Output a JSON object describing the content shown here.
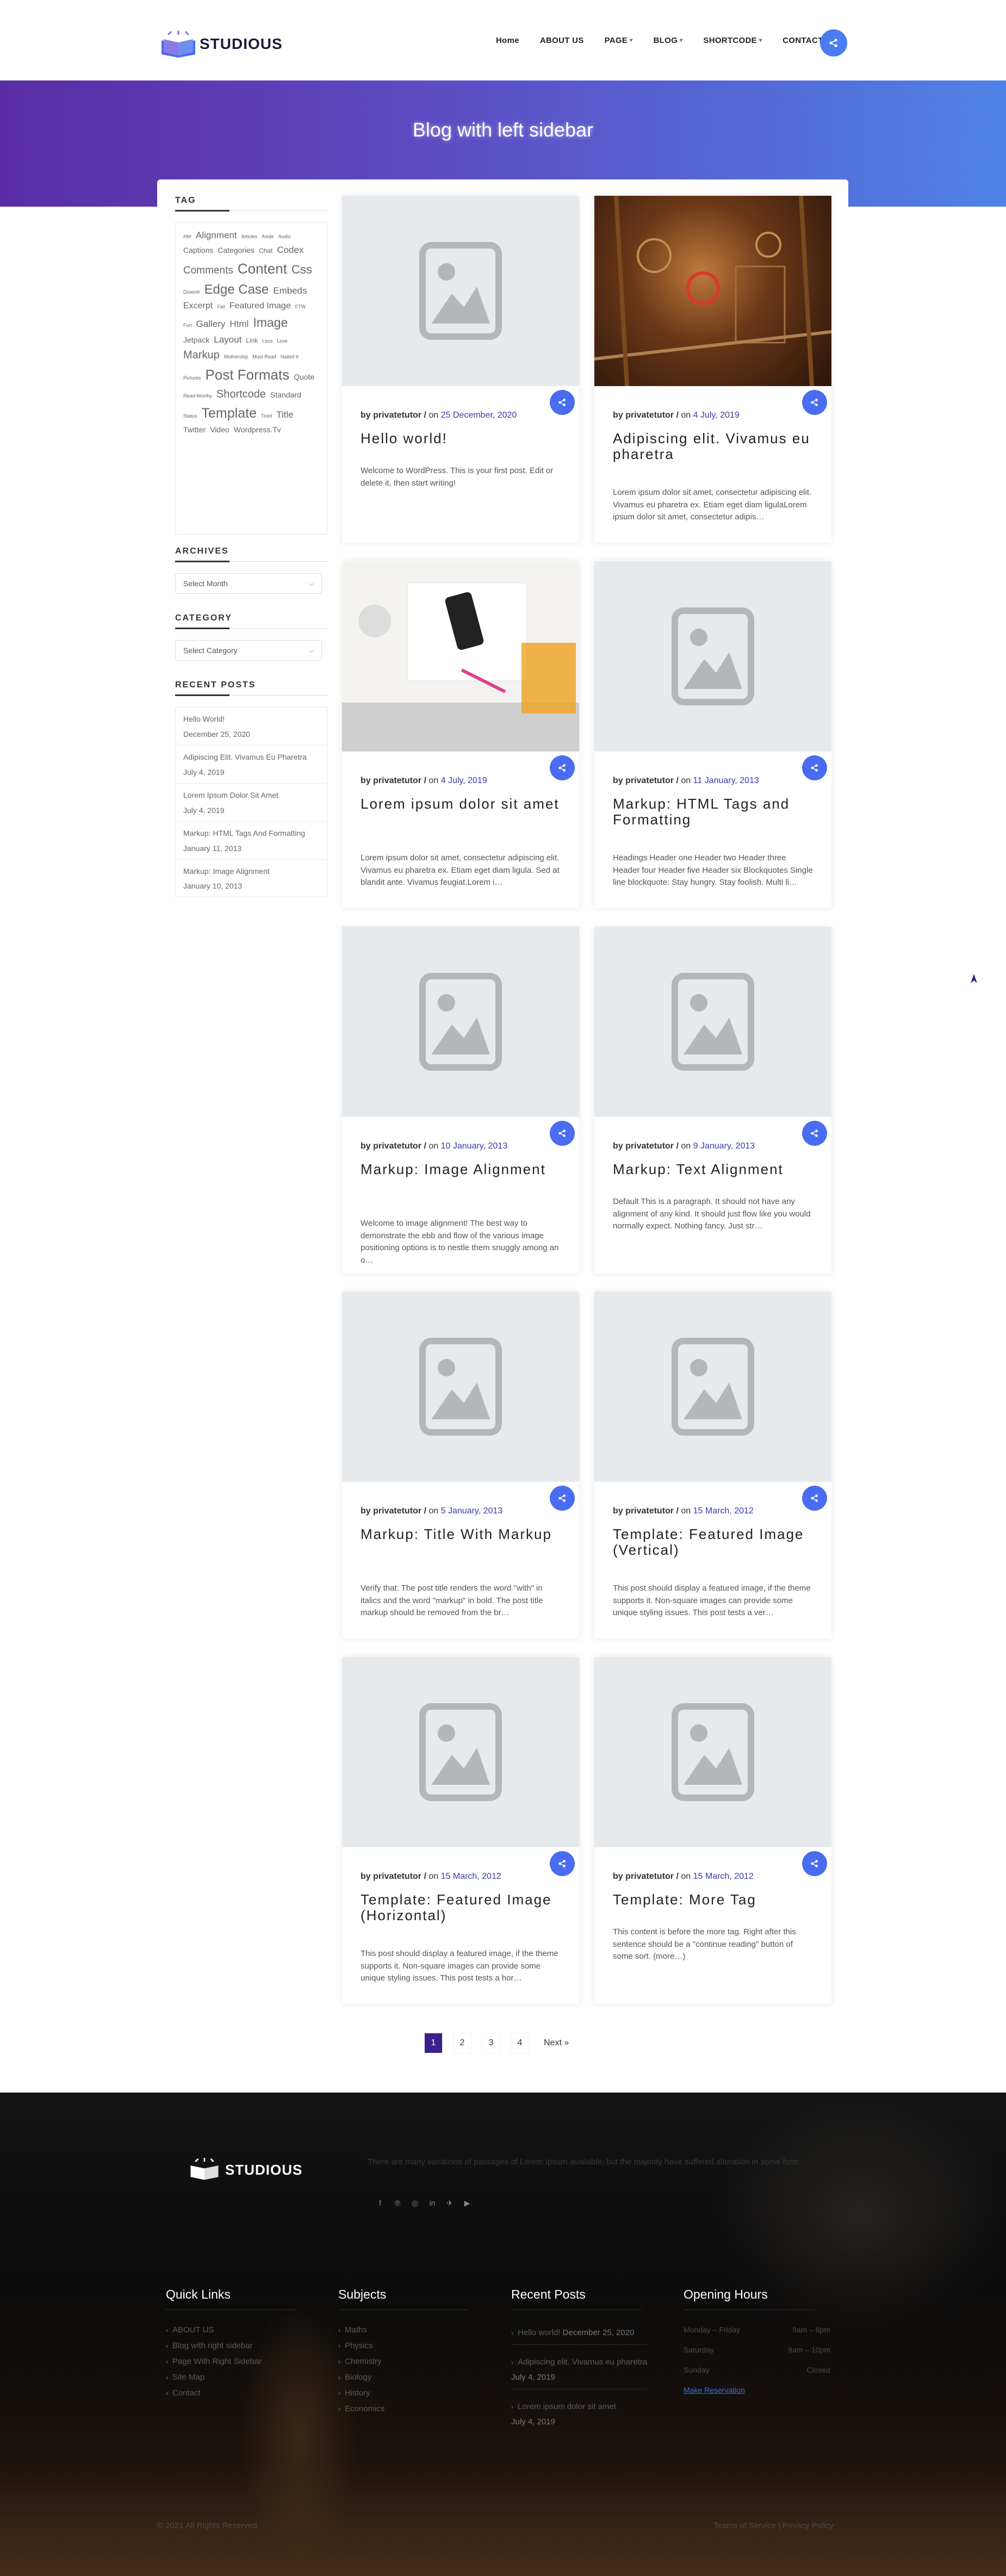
{
  "header": {
    "logo_text": "STUDIOUS",
    "nav": [
      "Home",
      "ABOUT US",
      "PAGE",
      "BLOG",
      "SHORTCODE",
      "CONTACT"
    ]
  },
  "banner": {
    "title": "Blog with left sidebar"
  },
  "sidebar": {
    "tag_heading": "TAG",
    "tags": [
      {
        "t": "#8#",
        "s": 9
      },
      {
        "t": "Alignment",
        "s": 17
      },
      {
        "t": "Articles",
        "s": 9
      },
      {
        "t": "Aside",
        "s": 9
      },
      {
        "t": "Audio",
        "s": 9
      },
      {
        "t": "Captions",
        "s": 14
      },
      {
        "t": "Categories",
        "s": 14
      },
      {
        "t": "Chat",
        "s": 12
      },
      {
        "t": "Codex",
        "s": 17
      },
      {
        "t": "Comments",
        "s": 19
      },
      {
        "t": "Content",
        "s": 26
      },
      {
        "t": "Css",
        "s": 22
      },
      {
        "t": "Dowork",
        "s": 9
      },
      {
        "t": "Edge Case",
        "s": 24
      },
      {
        "t": "Embeds",
        "s": 17
      },
      {
        "t": "Excerpt",
        "s": 16
      },
      {
        "t": "Fail",
        "s": 9
      },
      {
        "t": "Featured Image",
        "s": 16
      },
      {
        "t": "FTW",
        "s": 9
      },
      {
        "t": "Fun",
        "s": 9
      },
      {
        "t": "Gallery",
        "s": 17
      },
      {
        "t": "Html",
        "s": 17
      },
      {
        "t": "Image",
        "s": 23
      },
      {
        "t": "Jetpack",
        "s": 14
      },
      {
        "t": "Layout",
        "s": 17
      },
      {
        "t": "Link",
        "s": 12
      },
      {
        "t": "Less",
        "s": 9
      },
      {
        "t": "Love",
        "s": 9
      },
      {
        "t": "Markup",
        "s": 20
      },
      {
        "t": "Mothership",
        "s": 9
      },
      {
        "t": "Must Read",
        "s": 9
      },
      {
        "t": "Nailed It",
        "s": 9
      },
      {
        "t": "Pictures",
        "s": 9
      },
      {
        "t": "Post Formats",
        "s": 26
      },
      {
        "t": "Quote",
        "s": 14
      },
      {
        "t": "Read-Worthy",
        "s": 9
      },
      {
        "t": "Shortcode",
        "s": 20
      },
      {
        "t": "Standard",
        "s": 14
      },
      {
        "t": "Status",
        "s": 9
      },
      {
        "t": "Template",
        "s": 25
      },
      {
        "t": "Tired",
        "s": 9
      },
      {
        "t": "Title",
        "s": 17
      },
      {
        "t": "Twitter",
        "s": 14
      },
      {
        "t": "Video",
        "s": 14
      },
      {
        "t": "Wordpress.Tv",
        "s": 14
      }
    ],
    "archives_heading": "ARCHIVES",
    "archives_select": "Select Month",
    "category_heading": "CATEGORY",
    "category_select": "Select Category",
    "recent_heading": "RECENT POSTS",
    "recent_posts": [
      {
        "title": "Hello World!",
        "date": "December 25, 2020"
      },
      {
        "title": "Adipiscing Elit. Vivamus Eu Pharetra",
        "date": "July 4, 2019"
      },
      {
        "title": "Lorem Ipsum Dolor Sit Amet",
        "date": "July 4, 2019"
      },
      {
        "title": "Markup: HTML Tags And Formatting",
        "date": "January 11, 2013"
      },
      {
        "title": "Markup: Image Alignment",
        "date": "January 10, 2013"
      }
    ]
  },
  "posts": [
    {
      "author": "privatetutor",
      "on": "on",
      "date": "25 December, 2020",
      "title": "Hello world!",
      "excerpt": "Welcome to WordPress. This is your first post. Edit or delete it, then start writing!",
      "image": "placeholder"
    },
    {
      "author": "privatetutor",
      "on": "on",
      "date": "4 July, 2019",
      "title": "Adipiscing elit. Vivamus eu pharetra",
      "excerpt": "Lorem ipsum dolor sit amet, consectetur adipiscing elit. Vivamus eu pharetra ex. Etiam eget diam ligulaLorem ipsum dolor sit amet, consectetur adipis…",
      "image": "machinery"
    },
    {
      "author": "privatetutor",
      "on": "on",
      "date": "4 July, 2019",
      "title": "Lorem ipsum dolor sit amet",
      "excerpt": "Lorem ipsum dolor sit amet, consectetur adipiscing elit. Vivamus eu pharetra ex. Etiam eget diam ligula. Sed at blandit ante. Vivamus feugiat.Lorem i…",
      "image": "desk"
    },
    {
      "author": "privatetutor",
      "on": "on",
      "date": "11 January, 2013",
      "title": "Markup: HTML Tags and Formatting",
      "excerpt": "Headings Header one Header two Header three Header four Header five Header six Blockquotes Single line blockquote: Stay hungry. Stay foolish. Multi li…",
      "image": "placeholder"
    },
    {
      "author": "privatetutor",
      "on": "on",
      "date": "10 January, 2013",
      "title": "Markup: Image Alignment",
      "excerpt": "Welcome to image alignment! The best way to demonstrate the ebb and flow of the various image positioning options is to nestle them snuggly among an o…",
      "image": "placeholder"
    },
    {
      "author": "privatetutor",
      "on": "on",
      "date": "9 January, 2013",
      "title": "Markup: Text Alignment",
      "excerpt": "Default This is a paragraph. It should not have any alignment of any kind. It should just flow like you would normally expect. Nothing fancy. Just str…",
      "image": "placeholder"
    },
    {
      "author": "privatetutor",
      "on": "on",
      "date": "5 January, 2013",
      "title": "Markup: Title With Markup",
      "excerpt": "Verify that: The post title renders the word \"with\" in italics and the word \"markup\" in bold. The post title markup should be removed from the br…",
      "image": "placeholder"
    },
    {
      "author": "privatetutor",
      "on": "on",
      "date": "15 March, 2012",
      "title": "Template: Featured Image (Vertical)",
      "excerpt": "This post should display a featured image, if the theme supports it. Non-square images can provide some unique styling issues. This post tests a ver…",
      "image": "placeholder"
    },
    {
      "author": "privatetutor",
      "on": "on",
      "date": "15 March, 2012",
      "title": "Template: Featured Image (Horizontal)",
      "excerpt": "This post should display a featured image, if the theme supports it. Non-square images can provide some unique styling issues. This post tests a hor…",
      "image": "placeholder"
    },
    {
      "author": "privatetutor",
      "on": "on",
      "date": "15 March, 2012",
      "title": "Template: More Tag",
      "excerpt": "This content is before the more tag. Right after this sentence should be a \"continue reading\" button of some sort. (more…)",
      "image": "placeholder"
    }
  ],
  "pagination": {
    "pages": [
      "1",
      "2",
      "3",
      "4"
    ],
    "active": "1",
    "next": "Next »"
  },
  "footer": {
    "logo_text": "STUDIOUS",
    "text": "There are many variations of passages of Lorem Ipsum available, but the majority have suffered alteration in some form.",
    "social": [
      "f",
      "p",
      "ig",
      "in",
      "tw",
      "yt"
    ],
    "quick_links_heading": "Quick Links",
    "quick_links": [
      "ABOUT US",
      "Blog with right sidebar",
      "Page With Right Sidebar",
      "Site Map",
      "Contact"
    ],
    "subjects_heading": "Subjects",
    "subjects": [
      "Maths",
      "Physics",
      "Chemistry",
      "Biology",
      "History",
      "Economics"
    ],
    "recent_heading": "Recent Posts",
    "recent_posts": [
      {
        "title": "Hello world!",
        "date": "December 25, 2020"
      },
      {
        "title": "Adipiscing elit. Vivamus eu pharetra",
        "date": "July 4, 2019"
      },
      {
        "title": "Lorem ipsum dolor sit amet",
        "date": "July 4, 2019"
      }
    ],
    "hours_heading": "Opening Hours",
    "hours": [
      {
        "day": "Monday – Friday",
        "time": "9am – 6pm"
      },
      {
        "day": "Saturday",
        "time": "9am – 10pm"
      },
      {
        "day": "Sunday",
        "time": "Closed"
      }
    ],
    "reservation": "Make Reservation",
    "copyright": "© 2021 All Rights Reserved",
    "terms": "Teams of Service",
    "privacy": "Privacy Policy"
  },
  "colors": {
    "accent": "#4a6cf0",
    "banner_start": "#5a2ca3",
    "banner_end": "#4e82e6",
    "active_page": "#3b1f8c"
  }
}
